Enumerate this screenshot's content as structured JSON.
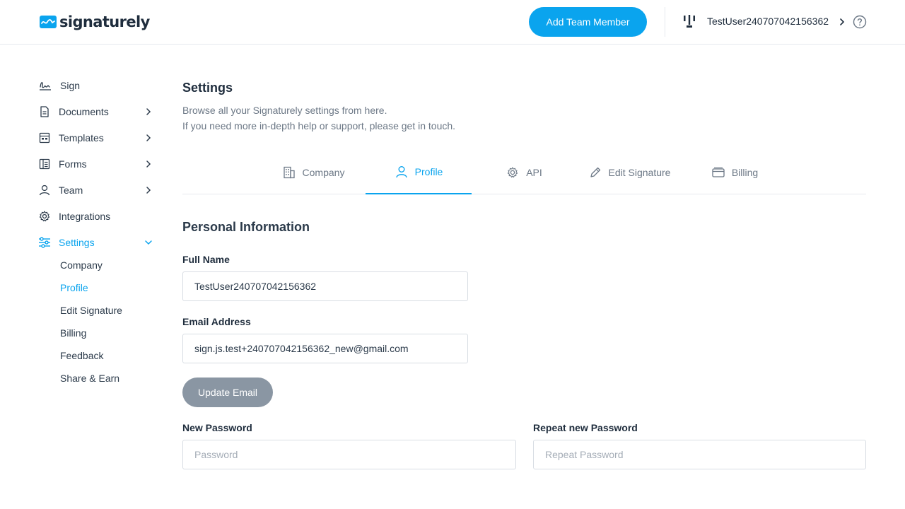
{
  "header": {
    "logo_text": "signaturely",
    "add_member_label": "Add Team Member",
    "user_name": "TestUser240707042156362"
  },
  "sidebar": {
    "items": [
      {
        "label": "Sign",
        "icon": "signature-icon"
      },
      {
        "label": "Documents",
        "icon": "document-icon"
      },
      {
        "label": "Templates",
        "icon": "template-icon"
      },
      {
        "label": "Forms",
        "icon": "form-icon"
      },
      {
        "label": "Team",
        "icon": "user-icon"
      },
      {
        "label": "Integrations",
        "icon": "gear-icon"
      },
      {
        "label": "Settings",
        "icon": "sliders-icon"
      }
    ],
    "settings_sub": [
      "Company",
      "Profile",
      "Edit Signature",
      "Billing",
      "Feedback",
      "Share & Earn"
    ]
  },
  "main": {
    "title": "Settings",
    "desc_line1": "Browse all your Signaturely settings from here.",
    "desc_line2": "If you need more in-depth help or support, please get in touch.",
    "tabs": [
      {
        "label": "Company",
        "icon": "building-icon"
      },
      {
        "label": "Profile",
        "icon": "user-icon"
      },
      {
        "label": "API",
        "icon": "gear-icon"
      },
      {
        "label": "Edit Signature",
        "icon": "pencil-icon"
      },
      {
        "label": "Billing",
        "icon": "card-icon"
      }
    ],
    "active_tab": "Profile",
    "section_title": "Personal Information",
    "full_name_label": "Full Name",
    "full_name_value": "TestUser240707042156362",
    "email_label": "Email Address",
    "email_value": "sign.js.test+240707042156362_new@gmail.com",
    "update_email_label": "Update Email",
    "new_password_label": "New Password",
    "new_password_placeholder": "Password",
    "repeat_password_label": "Repeat new Password",
    "repeat_password_placeholder": "Repeat Password"
  },
  "colors": {
    "accent": "#0aa4ee",
    "text_dark": "#1f2d3d",
    "text_muted": "#6b7785",
    "button_disabled": "#8a96a3"
  }
}
